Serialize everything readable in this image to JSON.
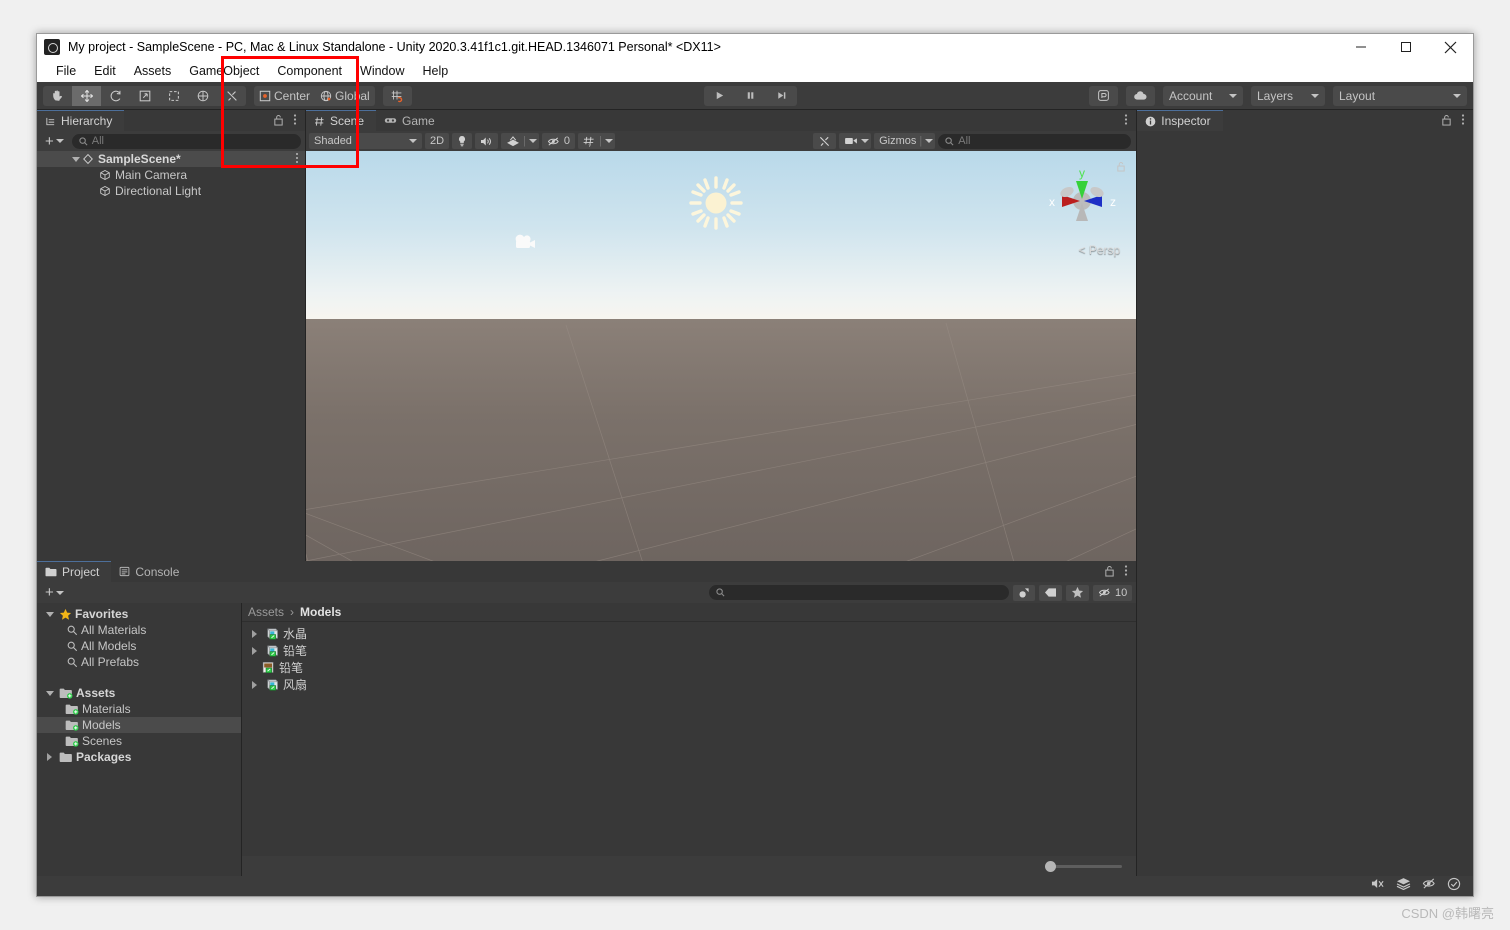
{
  "window": {
    "title": "My project - SampleScene - PC, Mac & Linux Standalone - Unity 2020.3.41f1c1.git.HEAD.1346071 Personal* <DX11>",
    "app_icon": "unity-icon",
    "minimize": "–",
    "maximize": "□",
    "close": "✕"
  },
  "menubar": {
    "items": [
      {
        "label": "File"
      },
      {
        "label": "Edit"
      },
      {
        "label": "Assets"
      },
      {
        "label": "GameObject"
      },
      {
        "label": "Component"
      },
      {
        "label": "Window"
      },
      {
        "label": "Help"
      }
    ]
  },
  "toolbar": {
    "tools": [
      {
        "name": "hand-tool-icon",
        "label": ""
      },
      {
        "name": "move-tool-icon",
        "label": ""
      },
      {
        "name": "rotate-tool-icon",
        "label": ""
      },
      {
        "name": "scale-tool-icon",
        "label": ""
      },
      {
        "name": "rect-tool-icon",
        "label": ""
      },
      {
        "name": "transform-tool-icon",
        "label": ""
      },
      {
        "name": "custom-tool-icon",
        "label": ""
      }
    ],
    "pivot_mode": "Center",
    "pivot_rotation": "Global",
    "snap_label": "",
    "play": "▶",
    "pause": "❚❚",
    "step": "▶|",
    "collab_label": "",
    "cloud_label": "",
    "account": "Account",
    "layers": "Layers",
    "layout": "Layout"
  },
  "hierarchy": {
    "tab": "Hierarchy",
    "tab_icon": "hierarchy-icon",
    "search_placeholder": "All",
    "add_label": "+",
    "rows": [
      {
        "label": "SampleScene*",
        "depth": 0,
        "icon": "scene-icon",
        "expanded": true,
        "selected": true
      },
      {
        "label": "Main Camera",
        "depth": 1,
        "icon": "gameobject-icon",
        "expanded": false,
        "selected": false
      },
      {
        "label": "Directional Light",
        "depth": 1,
        "icon": "gameobject-icon",
        "expanded": false,
        "selected": false
      }
    ]
  },
  "scene": {
    "tabs": [
      {
        "label": "Scene",
        "icon": "scene-tab-icon",
        "active": true
      },
      {
        "label": "Game",
        "icon": "game-tab-icon",
        "active": false
      }
    ],
    "draw_mode": "Shaded",
    "toggle_2d": "2D",
    "lighting_icon": "light-bulb-icon",
    "audio_icon": "audio-icon",
    "fx_icon": "effects-icon",
    "hidden_objects_count": "0",
    "grid_icon": "grid-icon",
    "tools_icon": "scene-tools-icon",
    "camera_icon": "scene-camera-icon",
    "gizmos_label": "Gizmos",
    "search_placeholder": "All",
    "axis_gizmo": {
      "x": "x",
      "y": "y",
      "z": "z",
      "perspective_label": "< Persp"
    },
    "objects": [
      {
        "name": "directional-light-gizmo",
        "icon": "sun-icon"
      },
      {
        "name": "main-camera-gizmo",
        "icon": "camera-icon"
      }
    ]
  },
  "inspector": {
    "tab": "Inspector",
    "tab_icon": "info-icon"
  },
  "project": {
    "tabs": [
      {
        "label": "Project",
        "icon": "folder-icon",
        "active": true
      },
      {
        "label": "Console",
        "icon": "console-icon",
        "active": false
      }
    ],
    "add_label": "+",
    "search_placeholder": "",
    "filter_icons": [
      "asset-type-filter-icon",
      "label-filter-icon",
      "favorite-filter-icon"
    ],
    "hidden_count": "10",
    "tree": [
      {
        "label": "Favorites",
        "depth": 0,
        "icon": "star-icon",
        "expanded": true,
        "bold": true,
        "selected": false
      },
      {
        "label": "All Materials",
        "depth": 1,
        "icon": "search-icon",
        "expanded": null,
        "bold": false,
        "selected": false
      },
      {
        "label": "All Models",
        "depth": 1,
        "icon": "search-icon",
        "expanded": null,
        "bold": false,
        "selected": false
      },
      {
        "label": "All Prefabs",
        "depth": 1,
        "icon": "search-icon",
        "expanded": null,
        "bold": false,
        "selected": false
      },
      {
        "label": "",
        "depth": 0,
        "icon": "spacer",
        "expanded": null,
        "bold": false,
        "selected": false
      },
      {
        "label": "Assets",
        "depth": 0,
        "icon": "assets-folder-icon",
        "expanded": true,
        "bold": true,
        "selected": false
      },
      {
        "label": "Materials",
        "depth": 1,
        "icon": "assets-folder-icon",
        "expanded": null,
        "bold": false,
        "selected": false
      },
      {
        "label": "Models",
        "depth": 1,
        "icon": "assets-folder-icon",
        "expanded": null,
        "bold": false,
        "selected": true
      },
      {
        "label": "Scenes",
        "depth": 1,
        "icon": "assets-folder-icon",
        "expanded": null,
        "bold": false,
        "selected": false
      },
      {
        "label": "Packages",
        "depth": 0,
        "icon": "folder-icon",
        "expanded": false,
        "bold": true,
        "selected": false
      }
    ],
    "breadcrumb": {
      "root": "Assets",
      "separator": "›",
      "current": "Models"
    },
    "assets": [
      {
        "label": "水晶",
        "icon": "model-asset-icon",
        "expandable": true
      },
      {
        "label": "铅笔",
        "icon": "model-asset-icon",
        "expandable": true
      },
      {
        "label": "铅笔",
        "icon": "texture-asset-icon",
        "expandable": false
      },
      {
        "label": "风扇",
        "icon": "model-asset-icon",
        "expandable": true
      }
    ],
    "zoom_slider_value": 12
  },
  "statusbar": {
    "icons": [
      "mute-audio-icon",
      "layers-status-icon",
      "no-gizmos-icon",
      "ready-check-icon"
    ]
  },
  "watermark": "CSDN @韩曙亮",
  "colors": {
    "accent_blue": "#4d6f9a",
    "highlight_red": "#ff0000",
    "panel_bg": "#383838",
    "toolbar_bg": "#3c3c3c",
    "selection": "#4b4b4b",
    "axis_x": "#b02525",
    "axis_y": "#2ecc2e",
    "axis_z": "#2030c8"
  }
}
